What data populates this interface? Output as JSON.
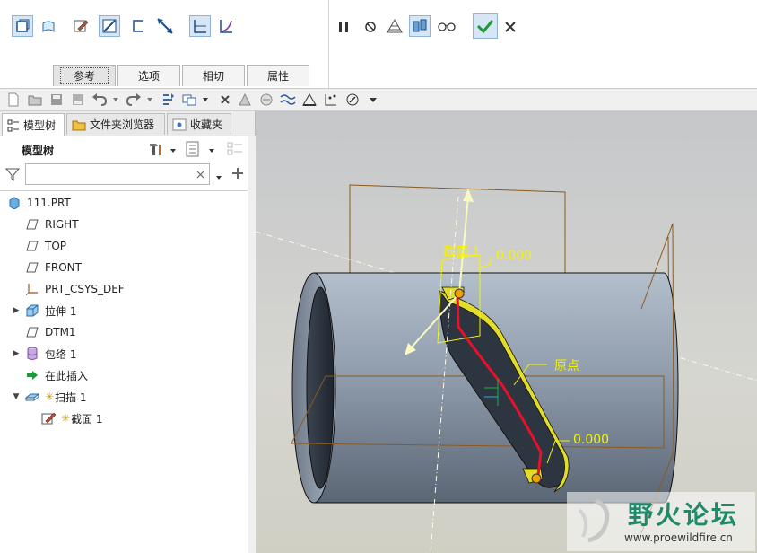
{
  "dashboard": {
    "tabs": [
      {
        "label": "参考"
      },
      {
        "label": "选项"
      },
      {
        "label": "相切"
      },
      {
        "label": "属性"
      }
    ],
    "colors": {
      "ok": "#1e9a3a",
      "selected_bg": "#d6e6f5"
    }
  },
  "panel": {
    "tabs": [
      {
        "label": "模型树"
      },
      {
        "label": "文件夹浏览器"
      },
      {
        "label": "收藏夹"
      }
    ],
    "header": "模型树",
    "search_value": "",
    "tree": [
      {
        "label": "111.PRT",
        "icon": "part-icon"
      },
      {
        "label": "RIGHT",
        "icon": "datum-plane-icon"
      },
      {
        "label": "TOP",
        "icon": "datum-plane-icon"
      },
      {
        "label": "FRONT",
        "icon": "datum-plane-icon"
      },
      {
        "label": "PRT_CSYS_DEF",
        "icon": "csys-icon"
      },
      {
        "label": "拉伸 1",
        "icon": "extrude-icon"
      },
      {
        "label": "DTM1",
        "icon": "datum-plane-icon"
      },
      {
        "label": "包络 1",
        "icon": "wrap-icon"
      },
      {
        "label": "在此插入",
        "icon": "insert-here-arrow-icon"
      },
      {
        "label": "扫描 1",
        "icon": "sweep-icon"
      },
      {
        "label": "截面 1",
        "icon": "sketch-icon"
      }
    ]
  },
  "viewport": {
    "labels": {
      "section": "截面 1",
      "value_top": "0.000",
      "origin": "原点",
      "value_bottom": "0.000"
    },
    "watermark": {
      "title": "野火论坛",
      "url": "www.proewildfire.cn"
    },
    "colors": {
      "annotation": "#f2f20a",
      "trajectory": "#e8102a",
      "datum": "#8a5a20",
      "cylinder": "#8f9cac"
    }
  }
}
